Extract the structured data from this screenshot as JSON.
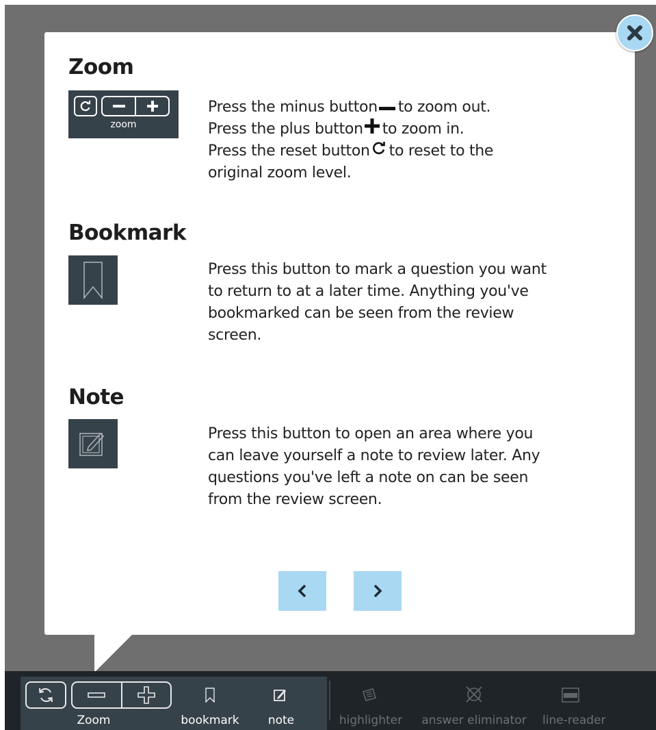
{
  "sections": {
    "zoom": {
      "title": "Zoom",
      "tile_label": "zoom",
      "lines": {
        "l1_a": "Press the minus button",
        "l1_b": "to zoom out.",
        "l2_a": "Press the plus button",
        "l2_b": "to zoom in.",
        "l3_a": "Press the reset button",
        "l3_b": "to reset to the",
        "l4": "original zoom level."
      }
    },
    "bookmark": {
      "title": "Bookmark",
      "lines": [
        "Press this button to mark a question you want",
        "to return to at a later time. Anything you've",
        "bookmarked can be seen from the review",
        "screen."
      ]
    },
    "note": {
      "title": "Note",
      "lines": [
        "Press this button to open an area where you",
        "can leave yourself a note to review later. Any",
        "questions you've left a note on can be seen",
        "from the review screen."
      ]
    }
  },
  "navigation": {
    "prev_icon": "chevron-left-icon",
    "next_icon": "chevron-right-icon"
  },
  "toolbar": {
    "zoom_label": "Zoom",
    "bookmark_label": "bookmark",
    "note_label": "note",
    "highlighter_label": "highlighter",
    "answer_eliminator_label": "answer eliminator",
    "line_reader_label": "line-reader"
  },
  "colors": {
    "backdrop": "#6f6f6f",
    "accent_button": "#a9d8f3",
    "tile": "#36424a",
    "toolbar": "#1f2429",
    "disabled_text": "#6a7279"
  }
}
